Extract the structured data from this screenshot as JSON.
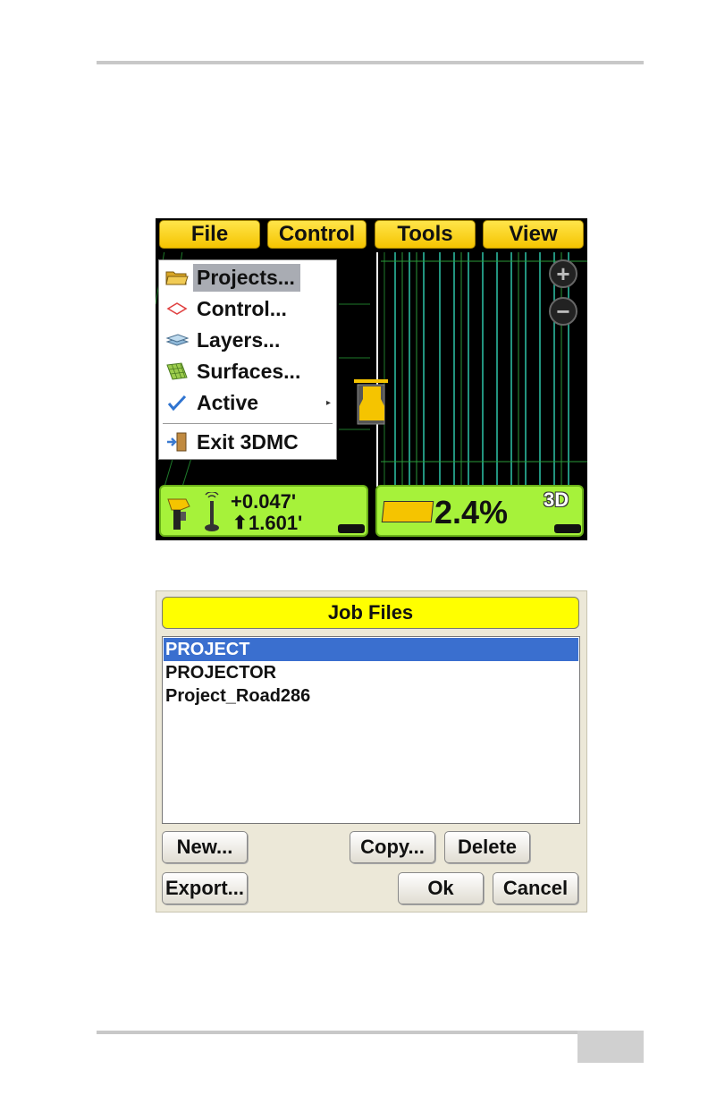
{
  "screen1": {
    "menu": [
      "File",
      "Control",
      "Tools",
      "View"
    ],
    "dropdown": [
      {
        "label": "Projects...",
        "icon": "folder-icon",
        "selected": true
      },
      {
        "label": "Control...",
        "icon": "control-point-icon",
        "selected": false
      },
      {
        "label": "Layers...",
        "icon": "layers-icon",
        "selected": false
      },
      {
        "label": "Surfaces...",
        "icon": "surface-icon",
        "selected": false
      },
      {
        "label": "Active",
        "icon": "checkmark-icon",
        "selected": false,
        "submenu": true
      },
      {
        "label": "Exit 3DMC",
        "icon": "exit-door-icon",
        "selected": false
      }
    ],
    "zoom_in": "+",
    "zoom_out": "−",
    "status_left": {
      "cut_fill": "+0.047'",
      "elevation": "1.601'"
    },
    "status_right": {
      "slope": "2.4%",
      "mode": "3D"
    },
    "colors": {
      "menu": "#f5c400",
      "status": "#a6f23a",
      "grid_lines": "#2ec4a8"
    }
  },
  "screen2": {
    "title": "Job Files",
    "files": [
      {
        "name": "PROJECT",
        "selected": true
      },
      {
        "name": "PROJECTOR",
        "selected": false
      },
      {
        "name": "Project_Road286",
        "selected": false
      }
    ],
    "buttons": {
      "new": "New...",
      "copy": "Copy...",
      "delete": "Delete",
      "export": "Export...",
      "ok": "Ok",
      "cancel": "Cancel"
    },
    "colors": {
      "title_bg": "#ffff00",
      "selection": "#3a6fcf"
    }
  }
}
